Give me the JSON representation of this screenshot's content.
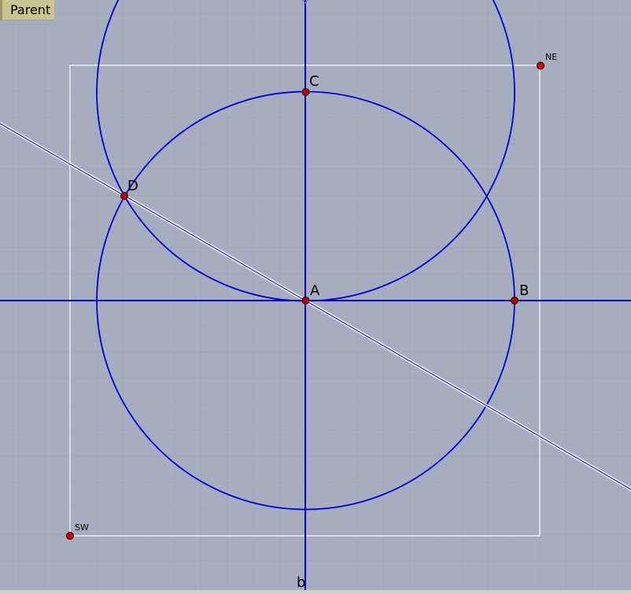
{
  "toolbar": {
    "parent_label": "Parent"
  },
  "canvas": {
    "background": "#a6adbf",
    "grid_color": "#97a0b2",
    "line_color": "#0000dd",
    "frame_color": "#ffffff",
    "point_color": "#c00000"
  },
  "points": {
    "A": {
      "label": "A"
    },
    "B": {
      "label": "B"
    },
    "C": {
      "label": "C"
    },
    "D": {
      "label": "D"
    },
    "NE": {
      "label": "NE"
    },
    "SW": {
      "label": "SW"
    }
  },
  "lines": {
    "vertical_axis": {
      "label": "b"
    }
  }
}
